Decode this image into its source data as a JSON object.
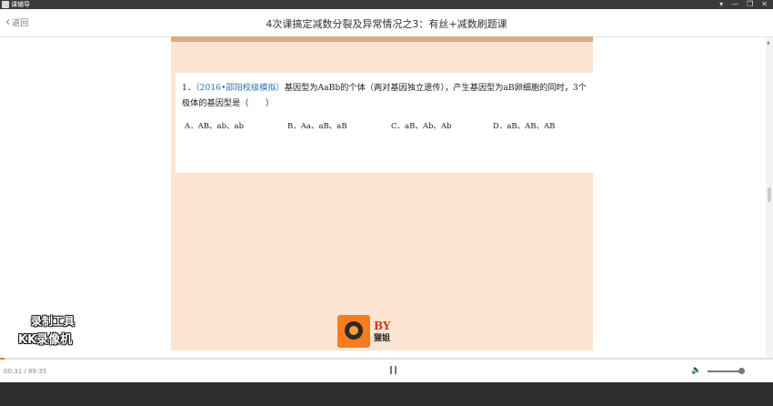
{
  "window": {
    "app_name": "课辅导",
    "controls": [
      "▾",
      "—",
      "❐",
      "✕"
    ]
  },
  "header": {
    "back_label": "返回",
    "title": "4次课搞定减数分裂及异常情况之3：有丝+减数刷题课"
  },
  "question": {
    "number": "1．",
    "source": "（2016•邵阳校级模拟）",
    "text": "基因型为AaBb的个体（两对基因独立遗传），产生基因型为aB卵细胞的同时，3个极体的基因型是（　　）",
    "options": [
      {
        "label": "A．AB、ab、ab"
      },
      {
        "label": "B．Aa、aB、aB"
      },
      {
        "label": "C．aB、Ab、Ab"
      },
      {
        "label": "D．aB、AB、AB"
      }
    ]
  },
  "brand": {
    "by_text": "BY",
    "name": "猩姐"
  },
  "watermark": {
    "line1": "录制工具",
    "line2": "KK录像机"
  },
  "player": {
    "time": "00:31 / 89:35",
    "progress": 0.006,
    "volume": 0.92
  },
  "colors": {
    "slide_bg": "#fde5d3",
    "slide_top": "#d8ad86",
    "accent": "#f57c1f",
    "source_link": "#2f6fb1"
  }
}
